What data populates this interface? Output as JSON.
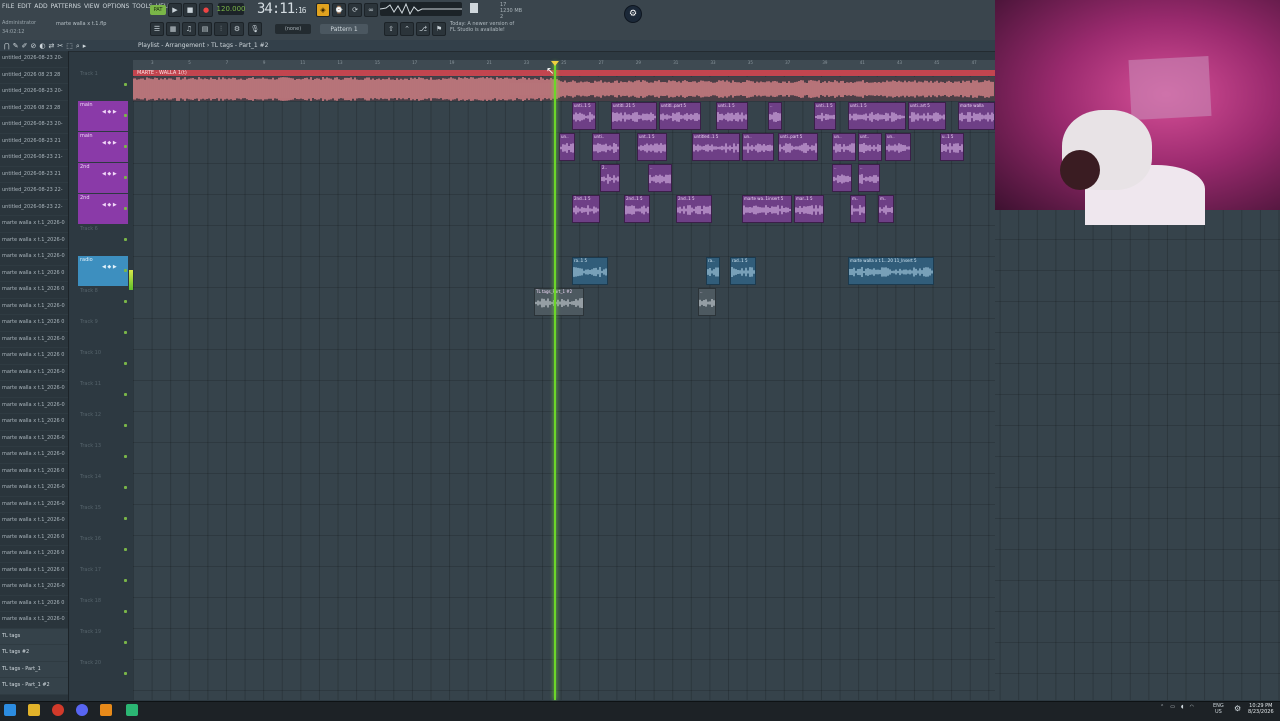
{
  "menu": [
    "FILE",
    "EDIT",
    "ADD",
    "PATTERNS",
    "VIEW",
    "OPTIONS",
    "TOOLS",
    "HELP"
  ],
  "hint": "Administrator",
  "hint_time": "34:02:12",
  "file_title": "marte walla x t.1.flp",
  "tempo": "120.000",
  "time": "34:11",
  "time_sub": ":16",
  "cpu": [
    "17",
    "1230 MB",
    "2"
  ],
  "pattern_none": "(none)",
  "pattern": "Pattern 1",
  "news": [
    "Today: A newer version of",
    "FL Studio is available!"
  ],
  "playlist": {
    "title": "Playlist - Arrangement",
    "breadcrumb": "TL tags - Part_1 #2"
  },
  "loop_label": "MARTE - WALLA 1(t)",
  "ruler_ticks": [
    "3",
    "5",
    "7",
    "9",
    "11",
    "13",
    "15",
    "17",
    "19",
    "21",
    "23",
    "25",
    "27",
    "29",
    "31",
    "33",
    "35",
    "37",
    "39",
    "41",
    "43",
    "45",
    "47",
    "49",
    "51",
    "53",
    "55",
    "57"
  ],
  "browser": [
    "untitled_2026-08-23 20-",
    "untitled_2026 08 23 28",
    "untitled_2026-08-23 20-",
    "untitled_2026 08 23 28",
    "untitled_2026-08-23 20-",
    "untitled_2026-08-23 21",
    "untitled_2026-08-23 21-",
    "untitled_2026-08-23 21",
    "untitled_2026-08-23 22-",
    "untitled_2026-08-23 22-",
    "marte walla x t.1_2026-0",
    "marte walla x t.1_2026-0",
    "marte walla x t.1_2026-0",
    "marte walla x t.1_2026 0",
    "marte walla x t.1_2026 0",
    "marte walla x t.1_2026-0",
    "marte walla x t.1_2026 0",
    "marte walla x t.1_2026-0",
    "marte walla x t.1_2026 0",
    "marte walla x t.1_2026-0",
    "marte walla x t.1_2026-0",
    "marte walla x t.1_2026-0",
    "marte walla x t.1_2026 0",
    "marte walla x t.1_2026-0",
    "marte walla x t.1_2026-0",
    "marte walla x t.1_2026 0",
    "marte walla x t.1_2026-0",
    "marte walla x t.1_2026-0",
    "marte walla x t.1_2026-0",
    "marte walla x t.1_2026 0",
    "marte walla x t.1_2026 0",
    "marte walla x t.1_2026 0",
    "marte walla x t.1_2026-0",
    "marte walla x t.1_2026 0",
    "marte walla x t.1_2026-0",
    "TL tags",
    "TL tags #2",
    "TL tags - Part_1",
    "TL tags - Part_1 #2"
  ],
  "tracks": [
    {
      "label": "Track 1",
      "kind": "empty"
    },
    {
      "label": "main",
      "kind": "purple"
    },
    {
      "label": "main",
      "kind": "purple"
    },
    {
      "label": "2nd",
      "kind": "purple"
    },
    {
      "label": "2nd",
      "kind": "purple"
    },
    {
      "label": "Track 6",
      "kind": "empty"
    },
    {
      "label": "radio",
      "kind": "blue"
    },
    {
      "label": "Track 8",
      "kind": "empty"
    },
    {
      "label": "Track 9",
      "kind": "empty"
    },
    {
      "label": "Track 10",
      "kind": "empty"
    },
    {
      "label": "Track 11",
      "kind": "empty"
    },
    {
      "label": "Track 12",
      "kind": "empty"
    },
    {
      "label": "Track 13",
      "kind": "empty"
    },
    {
      "label": "Track 14",
      "kind": "empty"
    },
    {
      "label": "Track 15",
      "kind": "empty"
    },
    {
      "label": "Track 16",
      "kind": "empty"
    },
    {
      "label": "Track 17",
      "kind": "empty"
    },
    {
      "label": "Track 18",
      "kind": "empty"
    },
    {
      "label": "Track 19",
      "kind": "empty"
    },
    {
      "label": "Track 20",
      "kind": "empty"
    }
  ],
  "clips": [
    {
      "track": 1,
      "name": "unti..1 5",
      "start": 572,
      "len": 24
    },
    {
      "track": 1,
      "name": "untitl..21 5",
      "start": 611,
      "len": 46
    },
    {
      "track": 1,
      "name": "untitl..part 5",
      "start": 659,
      "len": 42
    },
    {
      "track": 1,
      "name": "unti..1 5",
      "start": 716,
      "len": 32
    },
    {
      "track": 1,
      "name": "..",
      "start": 768,
      "len": 14
    },
    {
      "track": 1,
      "name": "unti..1 5",
      "start": 814,
      "len": 22
    },
    {
      "track": 1,
      "name": "unti..1 5",
      "start": 848,
      "len": 58
    },
    {
      "track": 1,
      "name": "unti..art 5",
      "start": 908,
      "len": 38
    },
    {
      "track": 1,
      "name": "marte walla",
      "start": 958,
      "len": 37
    },
    {
      "track": 2,
      "name": "un..",
      "start": 559,
      "len": 16
    },
    {
      "track": 2,
      "name": "unti..",
      "start": 592,
      "len": 28
    },
    {
      "track": 2,
      "name": "unt..1 5",
      "start": 637,
      "len": 30
    },
    {
      "track": 2,
      "name": "untitled..1 5",
      "start": 692,
      "len": 48
    },
    {
      "track": 2,
      "name": "un..",
      "start": 742,
      "len": 32
    },
    {
      "track": 2,
      "name": "unti..part 5",
      "start": 778,
      "len": 40
    },
    {
      "track": 2,
      "name": "un..",
      "start": 832,
      "len": 24
    },
    {
      "track": 2,
      "name": "unt..",
      "start": 858,
      "len": 24
    },
    {
      "track": 2,
      "name": "un..",
      "start": 885,
      "len": 26
    },
    {
      "track": 2,
      "name": "u..1 5",
      "start": 940,
      "len": 24
    },
    {
      "track": 3,
      "name": "2..",
      "start": 600,
      "len": 20
    },
    {
      "track": 3,
      "name": "..",
      "start": 648,
      "len": 24
    },
    {
      "track": 3,
      "name": "..",
      "start": 832,
      "len": 20
    },
    {
      "track": 3,
      "name": "..",
      "start": 858,
      "len": 22
    },
    {
      "track": 4,
      "name": "2nd..1 5",
      "start": 572,
      "len": 28
    },
    {
      "track": 4,
      "name": "2nd..1 5",
      "start": 624,
      "len": 26
    },
    {
      "track": 4,
      "name": "2nd..1 5",
      "start": 676,
      "len": 36
    },
    {
      "track": 4,
      "name": "marte wa..1insert 5",
      "start": 742,
      "len": 50
    },
    {
      "track": 4,
      "name": "mar..1 5",
      "start": 794,
      "len": 30
    },
    {
      "track": 4,
      "name": "m..",
      "start": 850,
      "len": 16
    },
    {
      "track": 4,
      "name": "m..",
      "start": 878,
      "len": 16
    },
    {
      "track": 6,
      "name": "ra..1 5",
      "start": 572,
      "len": 36,
      "blue": true
    },
    {
      "track": 6,
      "name": "ra..",
      "start": 706,
      "len": 14,
      "blue": true
    },
    {
      "track": 6,
      "name": "rad..1 5",
      "start": 730,
      "len": 26,
      "blue": true
    },
    {
      "track": 6,
      "name": "marte walla x t.1...20 11_Insert 5",
      "start": 848,
      "len": 86,
      "blue": true
    },
    {
      "track": 7,
      "name": "TL tags_Part_1 #2",
      "start": 534,
      "len": 50,
      "gray": true
    },
    {
      "track": 7,
      "name": "..",
      "start": 698,
      "len": 18,
      "gray": true
    }
  ],
  "tray": {
    "lang": [
      "ENG",
      "US"
    ],
    "time": "10:29 PM",
    "date": "8/23/2026"
  }
}
